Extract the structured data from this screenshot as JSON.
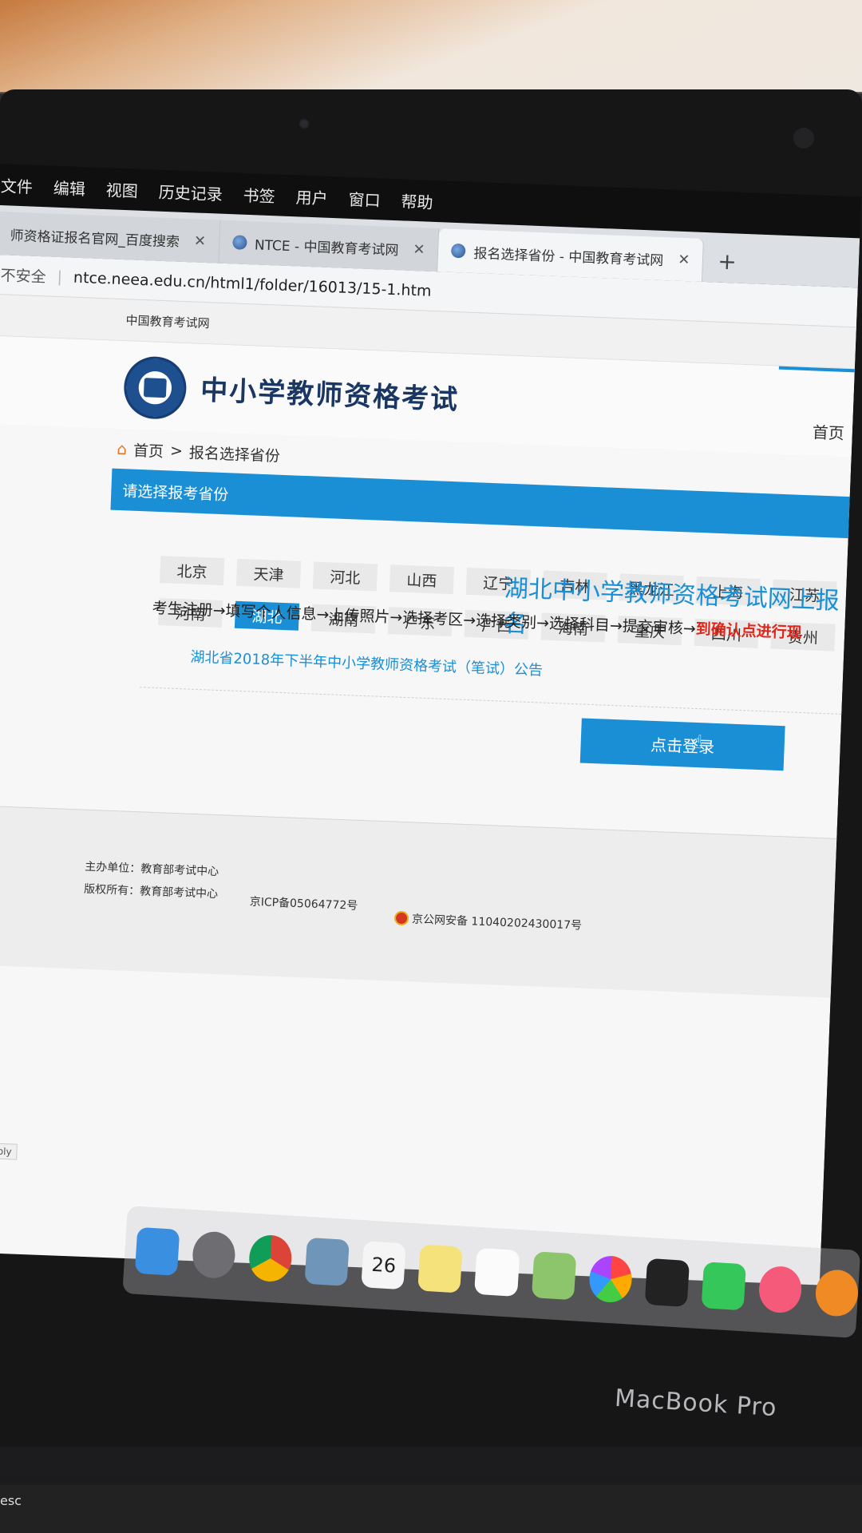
{
  "menu": [
    "文件",
    "编辑",
    "视图",
    "历史记录",
    "书签",
    "用户",
    "窗口",
    "帮助"
  ],
  "tabs": [
    {
      "label": "师资格证报名官网_百度搜索"
    },
    {
      "label": "NTCE - 中国教育考试网"
    },
    {
      "label": "报名选择省份 - 中国教育考试网"
    }
  ],
  "address": {
    "security": "不安全",
    "url": "ntce.neea.edu.cn/html1/folder/16013/15-1.htm"
  },
  "page": {
    "top_link": "中国教育考试网",
    "site_title": "中小学教师资格考试",
    "nav_home": "首页",
    "breadcrumb": {
      "home": "首页",
      "sep": ">",
      "current": "报名选择省份"
    },
    "section_title": "请选择报考省份",
    "provinces_row1": [
      "北京",
      "天津",
      "河北",
      "山西",
      "辽宁",
      "吉林",
      "黑龙江",
      "上海",
      "江苏"
    ],
    "provinces_row2": [
      "河南",
      "湖北",
      "湖南",
      "广东",
      "广西",
      "海南",
      "重庆",
      "四川",
      "贵州"
    ],
    "selected": "湖北",
    "hubei_title": "湖北中小学教师资格考试网上报名",
    "steps": "考生注册→填写个人信息→上传照片→选择考区→选择类别→选择科目→提交审核→",
    "steps_red": "到确认点进行现",
    "notice": "湖北省2018年下半年中小学教师资格考试（笔试）公告",
    "login_button": "点击登录"
  },
  "footer": {
    "host": "主办单位：教育部考试中心",
    "copyright": "版权所有：教育部考试中心",
    "icp": "京ICP备05064772号",
    "police": "京公网安备 11040202430017号"
  },
  "status_url": ".cn/apply",
  "dock": {
    "calendar_day": "26"
  },
  "device": {
    "brand": "MacBook Pro",
    "esc": "esc"
  }
}
